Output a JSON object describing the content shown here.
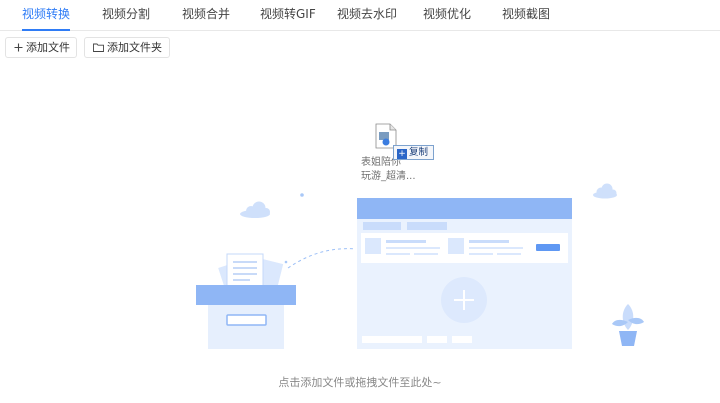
{
  "tabs": [
    {
      "label": "视频转换",
      "active": true
    },
    {
      "label": "视频分割"
    },
    {
      "label": "视频合并"
    },
    {
      "label": "视频转GIF"
    },
    {
      "label": "视频去水印"
    },
    {
      "label": "视频优化"
    },
    {
      "label": "视频截图"
    }
  ],
  "toolbar": {
    "add_file_label": "添加文件",
    "add_folder_label": "添加文件夹"
  },
  "drop_area": {
    "hint": "点击添加文件或拖拽文件至此处~",
    "dragged_file": {
      "name_line1": "表姐陪你",
      "name_line2": "玩游_超清..."
    },
    "copy_tooltip": "复制"
  },
  "colors": {
    "accent": "#2f7cf6",
    "illustration_blue": "#8fb6f5",
    "illustration_light": "#eaf2fe"
  }
}
